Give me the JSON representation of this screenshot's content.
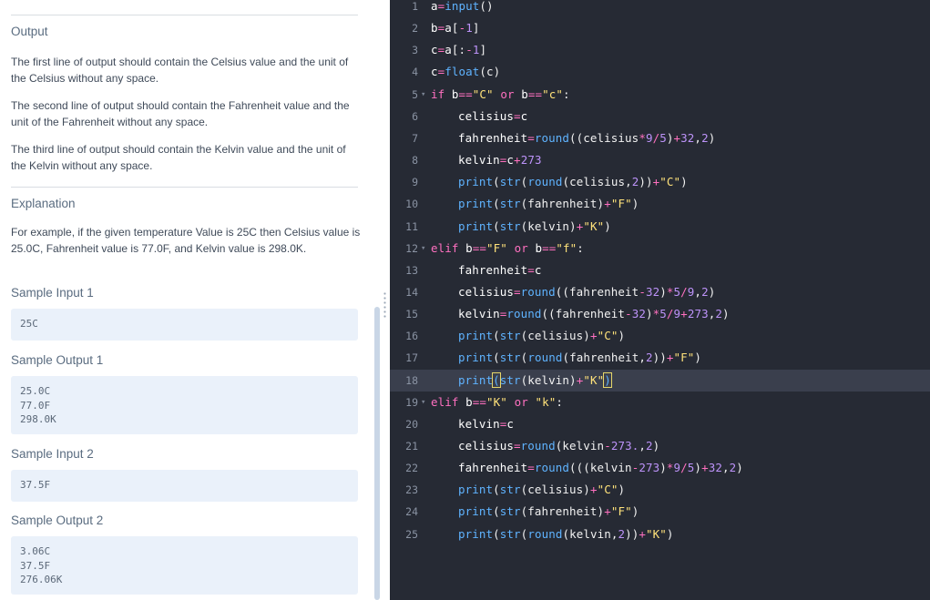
{
  "left_panel": {
    "output_heading": "Output",
    "output_paragraphs": [
      "The first line of output should contain the Celsius value and the unit of the Celsius without any space.",
      "The second line of output should contain the Fahrenheit value and the unit of the Fahrenheit without any space.",
      "The third line of output should contain the Kelvin value and the unit of the Kelvin without any space."
    ],
    "explanation_heading": "Explanation",
    "explanation_text": "For example, if the given temperature Value is 25C then Celsius value is 25.0C, Fahrenheit value is 77.0F, and Kelvin value is 298.0K.",
    "samples": [
      {
        "label": "Sample Input 1",
        "lines": [
          "25C"
        ]
      },
      {
        "label": "Sample Output 1",
        "lines": [
          "25.0C",
          "77.0F",
          "298.0K"
        ]
      },
      {
        "label": "Sample Input 2",
        "lines": [
          "37.5F"
        ]
      },
      {
        "label": "Sample Output 2",
        "lines": [
          "3.06C",
          "37.5F",
          "276.06K"
        ]
      }
    ]
  },
  "editor": {
    "active_line": 18,
    "lines": [
      {
        "n": "1",
        "fold": false,
        "indent": 0,
        "tokens": [
          [
            "var",
            "a"
          ],
          [
            "op",
            "="
          ],
          [
            "fn",
            "input"
          ],
          [
            "pl",
            "()"
          ]
        ]
      },
      {
        "n": "2",
        "fold": false,
        "indent": 0,
        "tokens": [
          [
            "var",
            "b"
          ],
          [
            "op",
            "="
          ],
          [
            "var",
            "a"
          ],
          [
            "pl",
            "["
          ],
          [
            "op",
            "-"
          ],
          [
            "num",
            "1"
          ],
          [
            "pl",
            "]"
          ]
        ]
      },
      {
        "n": "3",
        "fold": false,
        "indent": 0,
        "tokens": [
          [
            "var",
            "c"
          ],
          [
            "op",
            "="
          ],
          [
            "var",
            "a"
          ],
          [
            "pl",
            "[:"
          ],
          [
            "op",
            "-"
          ],
          [
            "num",
            "1"
          ],
          [
            "pl",
            "]"
          ]
        ]
      },
      {
        "n": "4",
        "fold": false,
        "indent": 0,
        "tokens": [
          [
            "var",
            "c"
          ],
          [
            "op",
            "="
          ],
          [
            "fn",
            "float"
          ],
          [
            "pl",
            "(c)"
          ]
        ]
      },
      {
        "n": "5",
        "fold": true,
        "indent": 0,
        "tokens": [
          [
            "kw",
            "if "
          ],
          [
            "var",
            "b"
          ],
          [
            "op",
            "=="
          ],
          [
            "str",
            "\"C\""
          ],
          [
            "kw",
            " or "
          ],
          [
            "var",
            "b"
          ],
          [
            "op",
            "=="
          ],
          [
            "str",
            "\"c\""
          ],
          [
            "pl",
            ":"
          ]
        ]
      },
      {
        "n": "6",
        "fold": false,
        "indent": 1,
        "tokens": [
          [
            "var",
            "celisius"
          ],
          [
            "op",
            "="
          ],
          [
            "var",
            "c"
          ]
        ]
      },
      {
        "n": "7",
        "fold": false,
        "indent": 1,
        "tokens": [
          [
            "var",
            "fahrenheit"
          ],
          [
            "op",
            "="
          ],
          [
            "fn",
            "round"
          ],
          [
            "pl",
            "((celisius"
          ],
          [
            "op",
            "*"
          ],
          [
            "num",
            "9"
          ],
          [
            "op",
            "/"
          ],
          [
            "num",
            "5"
          ],
          [
            "pl",
            ")"
          ],
          [
            "op",
            "+"
          ],
          [
            "num",
            "32"
          ],
          [
            "pl",
            ","
          ],
          [
            "num",
            "2"
          ],
          [
            "pl",
            ")"
          ]
        ]
      },
      {
        "n": "8",
        "fold": false,
        "indent": 1,
        "tokens": [
          [
            "var",
            "kelvin"
          ],
          [
            "op",
            "="
          ],
          [
            "var",
            "c"
          ],
          [
            "op",
            "+"
          ],
          [
            "num",
            "273"
          ]
        ]
      },
      {
        "n": "9",
        "fold": false,
        "indent": 1,
        "tokens": [
          [
            "fn",
            "print"
          ],
          [
            "pl",
            "("
          ],
          [
            "fn",
            "str"
          ],
          [
            "pl",
            "("
          ],
          [
            "fn",
            "round"
          ],
          [
            "pl",
            "(celisius,"
          ],
          [
            "num",
            "2"
          ],
          [
            "pl",
            "))"
          ],
          [
            "op",
            "+"
          ],
          [
            "str",
            "\"C\""
          ],
          [
            "pl",
            ")"
          ]
        ]
      },
      {
        "n": "10",
        "fold": false,
        "indent": 1,
        "tokens": [
          [
            "fn",
            "print"
          ],
          [
            "pl",
            "("
          ],
          [
            "fn",
            "str"
          ],
          [
            "pl",
            "(fahrenheit)"
          ],
          [
            "op",
            "+"
          ],
          [
            "str",
            "\"F\""
          ],
          [
            "pl",
            ")"
          ]
        ]
      },
      {
        "n": "11",
        "fold": false,
        "indent": 1,
        "tokens": [
          [
            "fn",
            "print"
          ],
          [
            "pl",
            "("
          ],
          [
            "fn",
            "str"
          ],
          [
            "pl",
            "(kelvin)"
          ],
          [
            "op",
            "+"
          ],
          [
            "str",
            "\"K\""
          ],
          [
            "pl",
            ")"
          ]
        ]
      },
      {
        "n": "12",
        "fold": true,
        "indent": 0,
        "tokens": [
          [
            "kw",
            "elif "
          ],
          [
            "var",
            "b"
          ],
          [
            "op",
            "=="
          ],
          [
            "str",
            "\"F\""
          ],
          [
            "kw",
            " or "
          ],
          [
            "var",
            "b"
          ],
          [
            "op",
            "=="
          ],
          [
            "str",
            "\"f\""
          ],
          [
            "pl",
            ":"
          ]
        ]
      },
      {
        "n": "13",
        "fold": false,
        "indent": 1,
        "tokens": [
          [
            "var",
            "fahrenheit"
          ],
          [
            "op",
            "="
          ],
          [
            "var",
            "c"
          ]
        ]
      },
      {
        "n": "14",
        "fold": false,
        "indent": 1,
        "tokens": [
          [
            "var",
            "celisius"
          ],
          [
            "op",
            "="
          ],
          [
            "fn",
            "round"
          ],
          [
            "pl",
            "((fahrenheit"
          ],
          [
            "op",
            "-"
          ],
          [
            "num",
            "32"
          ],
          [
            "pl",
            ")"
          ],
          [
            "op",
            "*"
          ],
          [
            "num",
            "5"
          ],
          [
            "op",
            "/"
          ],
          [
            "num",
            "9"
          ],
          [
            "pl",
            ","
          ],
          [
            "num",
            "2"
          ],
          [
            "pl",
            ")"
          ]
        ]
      },
      {
        "n": "15",
        "fold": false,
        "indent": 1,
        "tokens": [
          [
            "var",
            "kelvin"
          ],
          [
            "op",
            "="
          ],
          [
            "fn",
            "round"
          ],
          [
            "pl",
            "((fahrenheit"
          ],
          [
            "op",
            "-"
          ],
          [
            "num",
            "32"
          ],
          [
            "pl",
            ")"
          ],
          [
            "op",
            "*"
          ],
          [
            "num",
            "5"
          ],
          [
            "op",
            "/"
          ],
          [
            "num",
            "9"
          ],
          [
            "op",
            "+"
          ],
          [
            "num",
            "273"
          ],
          [
            "pl",
            ","
          ],
          [
            "num",
            "2"
          ],
          [
            "pl",
            ")"
          ]
        ]
      },
      {
        "n": "16",
        "fold": false,
        "indent": 1,
        "tokens": [
          [
            "fn",
            "print"
          ],
          [
            "pl",
            "("
          ],
          [
            "fn",
            "str"
          ],
          [
            "pl",
            "(celisius)"
          ],
          [
            "op",
            "+"
          ],
          [
            "str",
            "\"C\""
          ],
          [
            "pl",
            ")"
          ]
        ]
      },
      {
        "n": "17",
        "fold": false,
        "indent": 1,
        "tokens": [
          [
            "fn",
            "print"
          ],
          [
            "pl",
            "("
          ],
          [
            "fn",
            "str"
          ],
          [
            "pl",
            "("
          ],
          [
            "fn",
            "round"
          ],
          [
            "pl",
            "(fahrenheit,"
          ],
          [
            "num",
            "2"
          ],
          [
            "pl",
            "))"
          ],
          [
            "op",
            "+"
          ],
          [
            "str",
            "\"F\""
          ],
          [
            "pl",
            ")"
          ]
        ]
      },
      {
        "n": "18",
        "fold": false,
        "indent": 1,
        "tokens": [
          [
            "fn",
            "print"
          ],
          [
            "hl",
            "("
          ],
          [
            "fn",
            "str"
          ],
          [
            "pl",
            "(kelvin)"
          ],
          [
            "op",
            "+"
          ],
          [
            "str",
            "\"K\""
          ],
          [
            "hl",
            ")"
          ]
        ]
      },
      {
        "n": "19",
        "fold": true,
        "indent": 0,
        "tokens": [
          [
            "kw",
            "elif "
          ],
          [
            "var",
            "b"
          ],
          [
            "op",
            "=="
          ],
          [
            "str",
            "\"K\""
          ],
          [
            "kw",
            " or "
          ],
          [
            "str",
            "\"k\""
          ],
          [
            "pl",
            ":"
          ]
        ]
      },
      {
        "n": "20",
        "fold": false,
        "indent": 1,
        "tokens": [
          [
            "var",
            "kelvin"
          ],
          [
            "op",
            "="
          ],
          [
            "var",
            "c"
          ]
        ]
      },
      {
        "n": "21",
        "fold": false,
        "indent": 1,
        "tokens": [
          [
            "var",
            "celisius"
          ],
          [
            "op",
            "="
          ],
          [
            "fn",
            "round"
          ],
          [
            "pl",
            "(kelvin"
          ],
          [
            "op",
            "-"
          ],
          [
            "num",
            "273."
          ],
          [
            "pl",
            ","
          ],
          [
            "num",
            "2"
          ],
          [
            "pl",
            ")"
          ]
        ]
      },
      {
        "n": "22",
        "fold": false,
        "indent": 1,
        "tokens": [
          [
            "var",
            "fahrenheit"
          ],
          [
            "op",
            "="
          ],
          [
            "fn",
            "round"
          ],
          [
            "pl",
            "(((kelvin"
          ],
          [
            "op",
            "-"
          ],
          [
            "num",
            "273"
          ],
          [
            "pl",
            ")"
          ],
          [
            "op",
            "*"
          ],
          [
            "num",
            "9"
          ],
          [
            "op",
            "/"
          ],
          [
            "num",
            "5"
          ],
          [
            "pl",
            ")"
          ],
          [
            "op",
            "+"
          ],
          [
            "num",
            "32"
          ],
          [
            "pl",
            ","
          ],
          [
            "num",
            "2"
          ],
          [
            "pl",
            ")"
          ]
        ]
      },
      {
        "n": "23",
        "fold": false,
        "indent": 1,
        "tokens": [
          [
            "fn",
            "print"
          ],
          [
            "pl",
            "("
          ],
          [
            "fn",
            "str"
          ],
          [
            "pl",
            "(celisius)"
          ],
          [
            "op",
            "+"
          ],
          [
            "str",
            "\"C\""
          ],
          [
            "pl",
            ")"
          ]
        ]
      },
      {
        "n": "24",
        "fold": false,
        "indent": 1,
        "tokens": [
          [
            "fn",
            "print"
          ],
          [
            "pl",
            "("
          ],
          [
            "fn",
            "str"
          ],
          [
            "pl",
            "(fahrenheit)"
          ],
          [
            "op",
            "+"
          ],
          [
            "str",
            "\"F\""
          ],
          [
            "pl",
            ")"
          ]
        ]
      },
      {
        "n": "25",
        "fold": false,
        "indent": 1,
        "tokens": [
          [
            "fn",
            "print"
          ],
          [
            "pl",
            "("
          ],
          [
            "fn",
            "str"
          ],
          [
            "pl",
            "("
          ],
          [
            "fn",
            "round"
          ],
          [
            "pl",
            "(kelvin,"
          ],
          [
            "num",
            "2"
          ],
          [
            "pl",
            "))"
          ],
          [
            "op",
            "+"
          ],
          [
            "str",
            "\"K\""
          ],
          [
            "pl",
            ")"
          ]
        ]
      }
    ]
  }
}
